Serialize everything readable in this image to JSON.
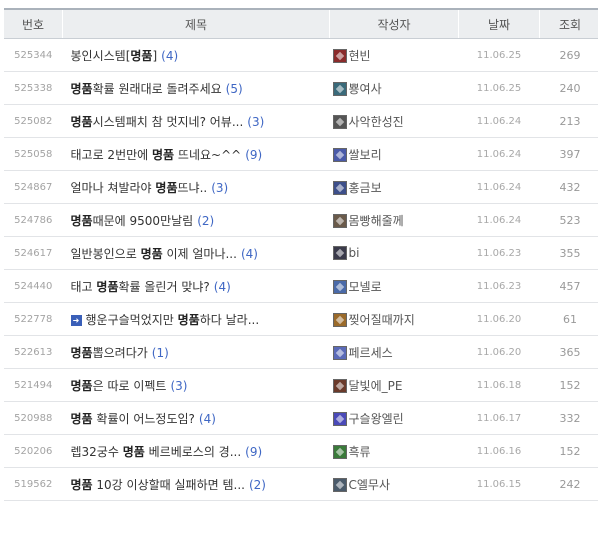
{
  "headers": {
    "num": "번호",
    "title": "제목",
    "author": "작성자",
    "date": "날짜",
    "views": "조회"
  },
  "rows": [
    {
      "num": "525344",
      "pre": "봉인시스템[",
      "hl": "명품",
      "post": "]",
      "comments": "(4)",
      "author": "현빈",
      "avatar_color": "#8a2b2b",
      "date": "11.06.25",
      "views": "269"
    },
    {
      "num": "525338",
      "pre": "",
      "hl": "명품",
      "post": "확률 원래대로 돌려주세요",
      "comments": "(5)",
      "author": "뿅여사",
      "avatar_color": "#3a6a7a",
      "date": "11.06.25",
      "views": "240"
    },
    {
      "num": "525082",
      "pre": "",
      "hl": "명품",
      "post": "시스템패치 참 멋지네? 어뷰...",
      "comments": "(3)",
      "author": "사악한성진",
      "avatar_color": "#555555",
      "date": "11.06.24",
      "views": "213"
    },
    {
      "num": "525058",
      "pre": "태고로 2번만에 ",
      "hl": "명품",
      "post": " 뜨네요~^^",
      "comments": "(9)",
      "author": "쌀보리",
      "avatar_color": "#4a5aa8",
      "date": "11.06.24",
      "views": "397"
    },
    {
      "num": "524867",
      "pre": "얼마나 쳐발라야 ",
      "hl": "명품",
      "post": "뜨냐..",
      "comments": "(3)",
      "author": "홍금보",
      "avatar_color": "#3d4f8a",
      "date": "11.06.24",
      "views": "432"
    },
    {
      "num": "524786",
      "pre": "",
      "hl": "명품",
      "post": "때문에 9500만날림",
      "comments": "(2)",
      "author": "몸빵해줄께",
      "avatar_color": "#6a5a4a",
      "date": "11.06.24",
      "views": "523"
    },
    {
      "num": "524617",
      "pre": "일반봉인으로 ",
      "hl": "명품",
      "post": " 이제 얼마나...",
      "comments": "(4)",
      "author": "bi",
      "avatar_color": "#3a3a4a",
      "date": "11.06.23",
      "views": "355"
    },
    {
      "num": "524440",
      "pre": "태고 ",
      "hl": "명품",
      "post": "확률 올린거 맞냐?",
      "comments": "(4)",
      "author": "모넬로",
      "avatar_color": "#4a6aa8",
      "date": "11.06.23",
      "views": "457"
    },
    {
      "num": "522778",
      "arrow": "➜",
      "pre": "행운구슬먹었지만 ",
      "hl": "명품",
      "post": "하다 날라...",
      "comments": "",
      "author": "찢어질때까지",
      "avatar_color": "#9a6a2a",
      "date": "11.06.20",
      "views": "61"
    },
    {
      "num": "522613",
      "pre": "",
      "hl": "명품",
      "post": "뽑으려다가",
      "comments": "(1)",
      "author": "페르세스",
      "avatar_color": "#5a6ab8",
      "date": "11.06.20",
      "views": "365"
    },
    {
      "num": "521494",
      "pre": "",
      "hl": "명품",
      "post": "은 따로 이펙트",
      "comments": "(3)",
      "author": "달빛에_PE",
      "avatar_color": "#6a3a2a",
      "date": "11.06.18",
      "views": "152"
    },
    {
      "num": "520988",
      "pre": "",
      "hl": "명품",
      "post": " 확률이 어느정도임?",
      "comments": "(4)",
      "author": "구슬왕엘린",
      "avatar_color": "#4a4ab8",
      "date": "11.06.17",
      "views": "332"
    },
    {
      "num": "520206",
      "pre": "렙32궁수 ",
      "hl": "명품",
      "post": " 베르베로스의 경...",
      "comments": "(9)",
      "author": "흑류",
      "avatar_color": "#3a7a3a",
      "date": "11.06.16",
      "views": "152"
    },
    {
      "num": "519562",
      "pre": "",
      "hl": "명품",
      "post": " 10강 이상할때 실패하면 템...",
      "comments": "(2)",
      "author": "C엘무사",
      "avatar_color": "#4a5a6a",
      "date": "11.06.15",
      "views": "242"
    }
  ]
}
